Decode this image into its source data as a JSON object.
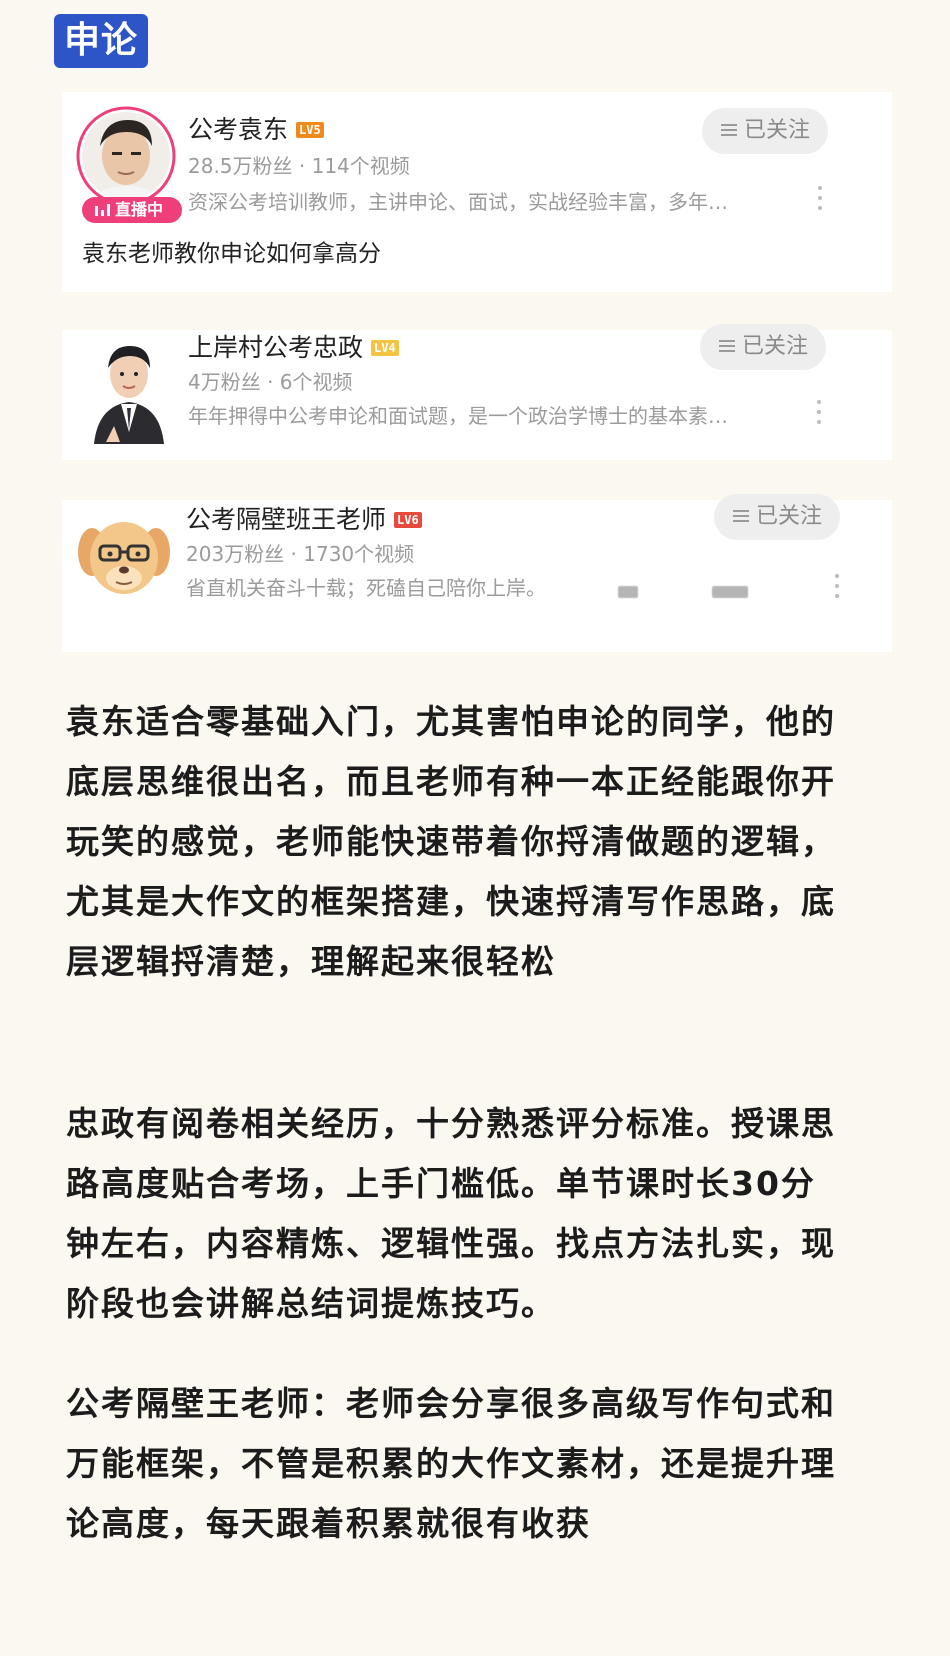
{
  "tag": {
    "label": "申论"
  },
  "cards": [
    {
      "name": "公考袁东",
      "level": "LV5",
      "stats": "28.5万粉丝 · 114个视频",
      "desc": "资深公考培训教师，主讲申论、面试，实战经验丰富，多年…",
      "follow_label": "已关注",
      "live_label": "直播中",
      "extra": "袁东老师教你申论如何拿高分"
    },
    {
      "name": "上岸村公考忠政",
      "level": "LV4",
      "stats": "4万粉丝 · 6个视频",
      "desc": "年年押得中公考申论和面试题，是一个政治学博士的基本素…",
      "follow_label": "已关注"
    },
    {
      "name": "公考隔壁班王老师",
      "level": "LV6",
      "stats": "203万粉丝 · 1730个视频",
      "desc": "省直机关奋斗十载；死磕自己陪你上岸。",
      "follow_label": "已关注"
    }
  ],
  "paragraphs": [
    "袁东适合零基础入门，尤其害怕申论的同学，他的底层思维很出名，而且老师有种一本正经能跟你开玩笑的感觉，老师能快速带着你捋清做题的逻辑，尤其是大作文的框架搭建，快速捋清写作思路，底层逻辑捋清楚，理解起来很轻松",
    "忠政有阅卷相关经历，十分熟悉评分标准。授课思路高度贴合考场，上手门槛低。单节课时长30分钟左右，内容精炼、逻辑性强。找点方法扎实，现阶段也会讲解总结词提炼技巧。",
    "公考隔壁王老师：老师会分享很多高级写作句式和万能框架，不管是积累的大作文素材，还是提升理论高度，每天跟着积累就很有收获"
  ],
  "colors": {
    "background": "#fbf7f1",
    "tag": "#2d55c8",
    "live": "#ef3f7a",
    "lv5": "#f08a1d",
    "lv4": "#f5c342",
    "lv6": "#e64a3c"
  }
}
